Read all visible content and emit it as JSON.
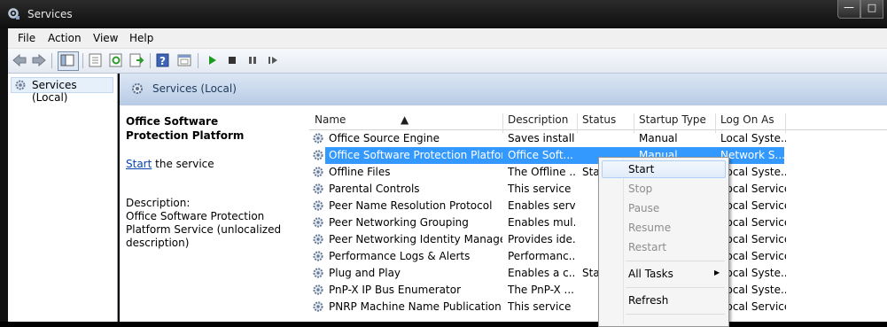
{
  "window": {
    "title": "Services",
    "icons": [
      "services-icon",
      "minimize-icon",
      "maximize-icon"
    ]
  },
  "menu": [
    "File",
    "Action",
    "View",
    "Help"
  ],
  "toolbar": {
    "icons": [
      "back-icon",
      "forward-icon",
      "show-hide-tree-icon",
      "properties-icon",
      "refresh-icon",
      "export-list-icon",
      "help-icon",
      "console-icon",
      "play-icon",
      "stop-icon",
      "pause-icon",
      "restart-icon"
    ]
  },
  "tree": {
    "root": "Services (Local)"
  },
  "panel": {
    "title": "Services (Local)",
    "detail_title": "Office Software Protection Platform",
    "start_link": "Start",
    "start_suffix": " the service",
    "description_label": "Description:",
    "description": "Office Software Protection Platform Service (unlocalized description)"
  },
  "columns": [
    "Name",
    "Description",
    "Status",
    "Startup Type",
    "Log On As"
  ],
  "rows": [
    {
      "name": "Office  Source Engine",
      "description": "Saves install...",
      "status": "",
      "startup": "Manual",
      "logon": "Local Syste..."
    },
    {
      "name": "Office Software Protection Platform",
      "description": "Office Soft...",
      "status": "",
      "startup": "Manual",
      "logon": "Network S..."
    },
    {
      "name": "Offline Files",
      "description": "The Offline ...",
      "status": "Sta",
      "startup": "",
      "logon": "Local Syste..."
    },
    {
      "name": "Parental Controls",
      "description": "This service ...",
      "status": "",
      "startup": "",
      "logon": "Local Service"
    },
    {
      "name": "Peer Name Resolution Protocol",
      "description": "Enables serv...",
      "status": "",
      "startup": "",
      "logon": "Local Service"
    },
    {
      "name": "Peer Networking Grouping",
      "description": "Enables mul...",
      "status": "",
      "startup": "",
      "logon": "Local Service"
    },
    {
      "name": "Peer Networking Identity Manager",
      "description": "Provides ide...",
      "status": "",
      "startup": "",
      "logon": "Local Service"
    },
    {
      "name": "Performance Logs & Alerts",
      "description": "Performanc...",
      "status": "",
      "startup": "",
      "logon": "Local Service"
    },
    {
      "name": "Plug and Play",
      "description": "Enables a c...",
      "status": "Sta",
      "startup": "",
      "logon": "Local Syste..."
    },
    {
      "name": "PnP-X IP Bus Enumerator",
      "description": "The PnP-X ...",
      "status": "",
      "startup": "",
      "logon": "Local Syste..."
    },
    {
      "name": "PNRP Machine Name Publication ...",
      "description": "This service ...",
      "status": "",
      "startup": "",
      "logon": "Local Service"
    }
  ],
  "context_menu": {
    "items": [
      {
        "label": "Start",
        "enabled": true
      },
      {
        "label": "Stop",
        "enabled": false
      },
      {
        "label": "Pause",
        "enabled": false
      },
      {
        "label": "Resume",
        "enabled": false
      },
      {
        "label": "Restart",
        "enabled": false
      },
      {
        "label": "All Tasks",
        "enabled": true
      },
      {
        "label": "Refresh",
        "enabled": true
      }
    ]
  },
  "colors": {
    "selection": "#3399ff",
    "header": "#b8cbe5",
    "link": "#0645ad"
  }
}
